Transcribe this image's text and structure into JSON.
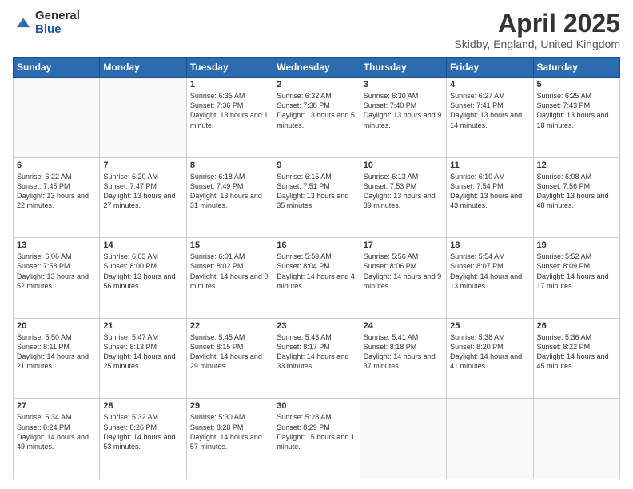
{
  "logo": {
    "general": "General",
    "blue": "Blue"
  },
  "title": {
    "month_year": "April 2025",
    "location": "Skidby, England, United Kingdom"
  },
  "weekdays": [
    "Sunday",
    "Monday",
    "Tuesday",
    "Wednesday",
    "Thursday",
    "Friday",
    "Saturday"
  ],
  "weeks": [
    [
      {
        "day": "",
        "info": ""
      },
      {
        "day": "",
        "info": ""
      },
      {
        "day": "1",
        "info": "Sunrise: 6:35 AM\nSunset: 7:36 PM\nDaylight: 13 hours and 1 minute."
      },
      {
        "day": "2",
        "info": "Sunrise: 6:32 AM\nSunset: 7:38 PM\nDaylight: 13 hours and 5 minutes."
      },
      {
        "day": "3",
        "info": "Sunrise: 6:30 AM\nSunset: 7:40 PM\nDaylight: 13 hours and 9 minutes."
      },
      {
        "day": "4",
        "info": "Sunrise: 6:27 AM\nSunset: 7:41 PM\nDaylight: 13 hours and 14 minutes."
      },
      {
        "day": "5",
        "info": "Sunrise: 6:25 AM\nSunset: 7:43 PM\nDaylight: 13 hours and 18 minutes."
      }
    ],
    [
      {
        "day": "6",
        "info": "Sunrise: 6:22 AM\nSunset: 7:45 PM\nDaylight: 13 hours and 22 minutes."
      },
      {
        "day": "7",
        "info": "Sunrise: 6:20 AM\nSunset: 7:47 PM\nDaylight: 13 hours and 27 minutes."
      },
      {
        "day": "8",
        "info": "Sunrise: 6:18 AM\nSunset: 7:49 PM\nDaylight: 13 hours and 31 minutes."
      },
      {
        "day": "9",
        "info": "Sunrise: 6:15 AM\nSunset: 7:51 PM\nDaylight: 13 hours and 35 minutes."
      },
      {
        "day": "10",
        "info": "Sunrise: 6:13 AM\nSunset: 7:53 PM\nDaylight: 13 hours and 39 minutes."
      },
      {
        "day": "11",
        "info": "Sunrise: 6:10 AM\nSunset: 7:54 PM\nDaylight: 13 hours and 43 minutes."
      },
      {
        "day": "12",
        "info": "Sunrise: 6:08 AM\nSunset: 7:56 PM\nDaylight: 13 hours and 48 minutes."
      }
    ],
    [
      {
        "day": "13",
        "info": "Sunrise: 6:06 AM\nSunset: 7:58 PM\nDaylight: 13 hours and 52 minutes."
      },
      {
        "day": "14",
        "info": "Sunrise: 6:03 AM\nSunset: 8:00 PM\nDaylight: 13 hours and 56 minutes."
      },
      {
        "day": "15",
        "info": "Sunrise: 6:01 AM\nSunset: 8:02 PM\nDaylight: 14 hours and 0 minutes."
      },
      {
        "day": "16",
        "info": "Sunrise: 5:59 AM\nSunset: 8:04 PM\nDaylight: 14 hours and 4 minutes."
      },
      {
        "day": "17",
        "info": "Sunrise: 5:56 AM\nSunset: 8:06 PM\nDaylight: 14 hours and 9 minutes."
      },
      {
        "day": "18",
        "info": "Sunrise: 5:54 AM\nSunset: 8:07 PM\nDaylight: 14 hours and 13 minutes."
      },
      {
        "day": "19",
        "info": "Sunrise: 5:52 AM\nSunset: 8:09 PM\nDaylight: 14 hours and 17 minutes."
      }
    ],
    [
      {
        "day": "20",
        "info": "Sunrise: 5:50 AM\nSunset: 8:11 PM\nDaylight: 14 hours and 21 minutes."
      },
      {
        "day": "21",
        "info": "Sunrise: 5:47 AM\nSunset: 8:13 PM\nDaylight: 14 hours and 25 minutes."
      },
      {
        "day": "22",
        "info": "Sunrise: 5:45 AM\nSunset: 8:15 PM\nDaylight: 14 hours and 29 minutes."
      },
      {
        "day": "23",
        "info": "Sunrise: 5:43 AM\nSunset: 8:17 PM\nDaylight: 14 hours and 33 minutes."
      },
      {
        "day": "24",
        "info": "Sunrise: 5:41 AM\nSunset: 8:18 PM\nDaylight: 14 hours and 37 minutes."
      },
      {
        "day": "25",
        "info": "Sunrise: 5:38 AM\nSunset: 8:20 PM\nDaylight: 14 hours and 41 minutes."
      },
      {
        "day": "26",
        "info": "Sunrise: 5:36 AM\nSunset: 8:22 PM\nDaylight: 14 hours and 45 minutes."
      }
    ],
    [
      {
        "day": "27",
        "info": "Sunrise: 5:34 AM\nSunset: 8:24 PM\nDaylight: 14 hours and 49 minutes."
      },
      {
        "day": "28",
        "info": "Sunrise: 5:32 AM\nSunset: 8:26 PM\nDaylight: 14 hours and 53 minutes."
      },
      {
        "day": "29",
        "info": "Sunrise: 5:30 AM\nSunset: 8:28 PM\nDaylight: 14 hours and 57 minutes."
      },
      {
        "day": "30",
        "info": "Sunrise: 5:28 AM\nSunset: 8:29 PM\nDaylight: 15 hours and 1 minute."
      },
      {
        "day": "",
        "info": ""
      },
      {
        "day": "",
        "info": ""
      },
      {
        "day": "",
        "info": ""
      }
    ]
  ]
}
